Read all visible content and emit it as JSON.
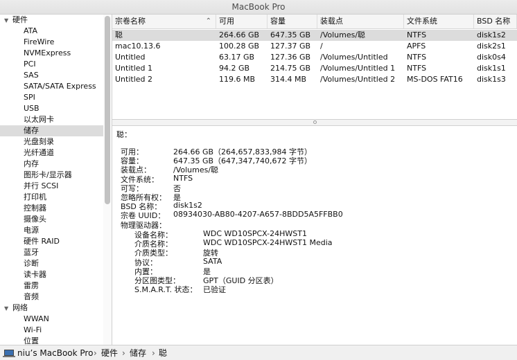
{
  "window": {
    "title": "MacBook Pro"
  },
  "sidebar": {
    "categories": [
      {
        "label": "硬件",
        "expanded": true,
        "items": [
          "ATA",
          "FireWire",
          "NVMExpress",
          "PCI",
          "SAS",
          "SATA/SATA Express",
          "SPI",
          "USB",
          "以太网卡",
          "储存",
          "光盘刻录",
          "光纤通道",
          "内存",
          "图形卡/显示器",
          "并行 SCSI",
          "打印机",
          "控制器",
          "摄像头",
          "电源",
          "硬件 RAID",
          "蓝牙",
          "诊断",
          "读卡器",
          "雷雳",
          "音频"
        ]
      },
      {
        "label": "网络",
        "expanded": true,
        "items": [
          "WWAN",
          "Wi-Fi",
          "位置"
        ]
      }
    ],
    "selected_item": "储存"
  },
  "table": {
    "columns": [
      "宗卷名称",
      "可用",
      "容量",
      "装载点",
      "文件系统",
      "BSD 名称"
    ],
    "sorted_column": "宗卷名称",
    "rows": [
      [
        "聪",
        "264.66 GB",
        "647.35 GB",
        "/Volumes/聪",
        "NTFS",
        "disk1s2"
      ],
      [
        "mac10.13.6",
        "100.28 GB",
        "127.37 GB",
        "/",
        "APFS",
        "disk2s1"
      ],
      [
        "Untitled",
        "63.17 GB",
        "127.36 GB",
        "/Volumes/Untitled",
        "NTFS",
        "disk0s4"
      ],
      [
        "Untitled 1",
        "94.2 GB",
        "214.75 GB",
        "/Volumes/Untitled 1",
        "NTFS",
        "disk1s1"
      ],
      [
        "Untitled 2",
        "119.6 MB",
        "314.4 MB",
        "/Volumes/Untitled 2",
        "MS-DOS FAT16",
        "disk1s3"
      ]
    ],
    "selected_row": 0
  },
  "detail": {
    "heading": "聪：",
    "fields": [
      {
        "label": "可用：",
        "value": "264.66 GB（264,657,833,984 字节）"
      },
      {
        "label": "容量：",
        "value": "647.35 GB（647,347,740,672 字节）"
      },
      {
        "label": "装载点：",
        "value": "/Volumes/聪"
      },
      {
        "label": "文件系统：",
        "value": "NTFS"
      },
      {
        "label": "可写：",
        "value": "否"
      },
      {
        "label": "忽略所有权：",
        "value": "是"
      },
      {
        "label": "BSD 名称：",
        "value": "disk1s2"
      },
      {
        "label": "宗卷 UUID：",
        "value": "08934030-AB80-4207-A657-8BDD5A5FFBB0"
      }
    ],
    "drive_heading": "物理驱动器：",
    "drive_fields": [
      {
        "label": "设备名称：",
        "value": "WDC WD10SPCX-24HWST1"
      },
      {
        "label": "介质名称：",
        "value": "WDC WD10SPCX-24HWST1 Media"
      },
      {
        "label": "介质类型：",
        "value": "旋转"
      },
      {
        "label": "协议：",
        "value": "SATA"
      },
      {
        "label": "内置：",
        "value": "是"
      },
      {
        "label": "分区图类型：",
        "value": "GPT（GUID 分区表）"
      },
      {
        "label": "S.M.A.R.T. 状态：",
        "value": "已验证"
      }
    ]
  },
  "breadcrumb": [
    "niu’s MacBook Pro",
    "硬件",
    "储存",
    "聪"
  ],
  "breadcrumb_separator": "›",
  "icons": {
    "category_expanded": "triangle-down-icon",
    "sort": "chevron-up-icon",
    "computer": "laptop-icon"
  },
  "colors": {
    "selection": "#dcdcdc"
  }
}
